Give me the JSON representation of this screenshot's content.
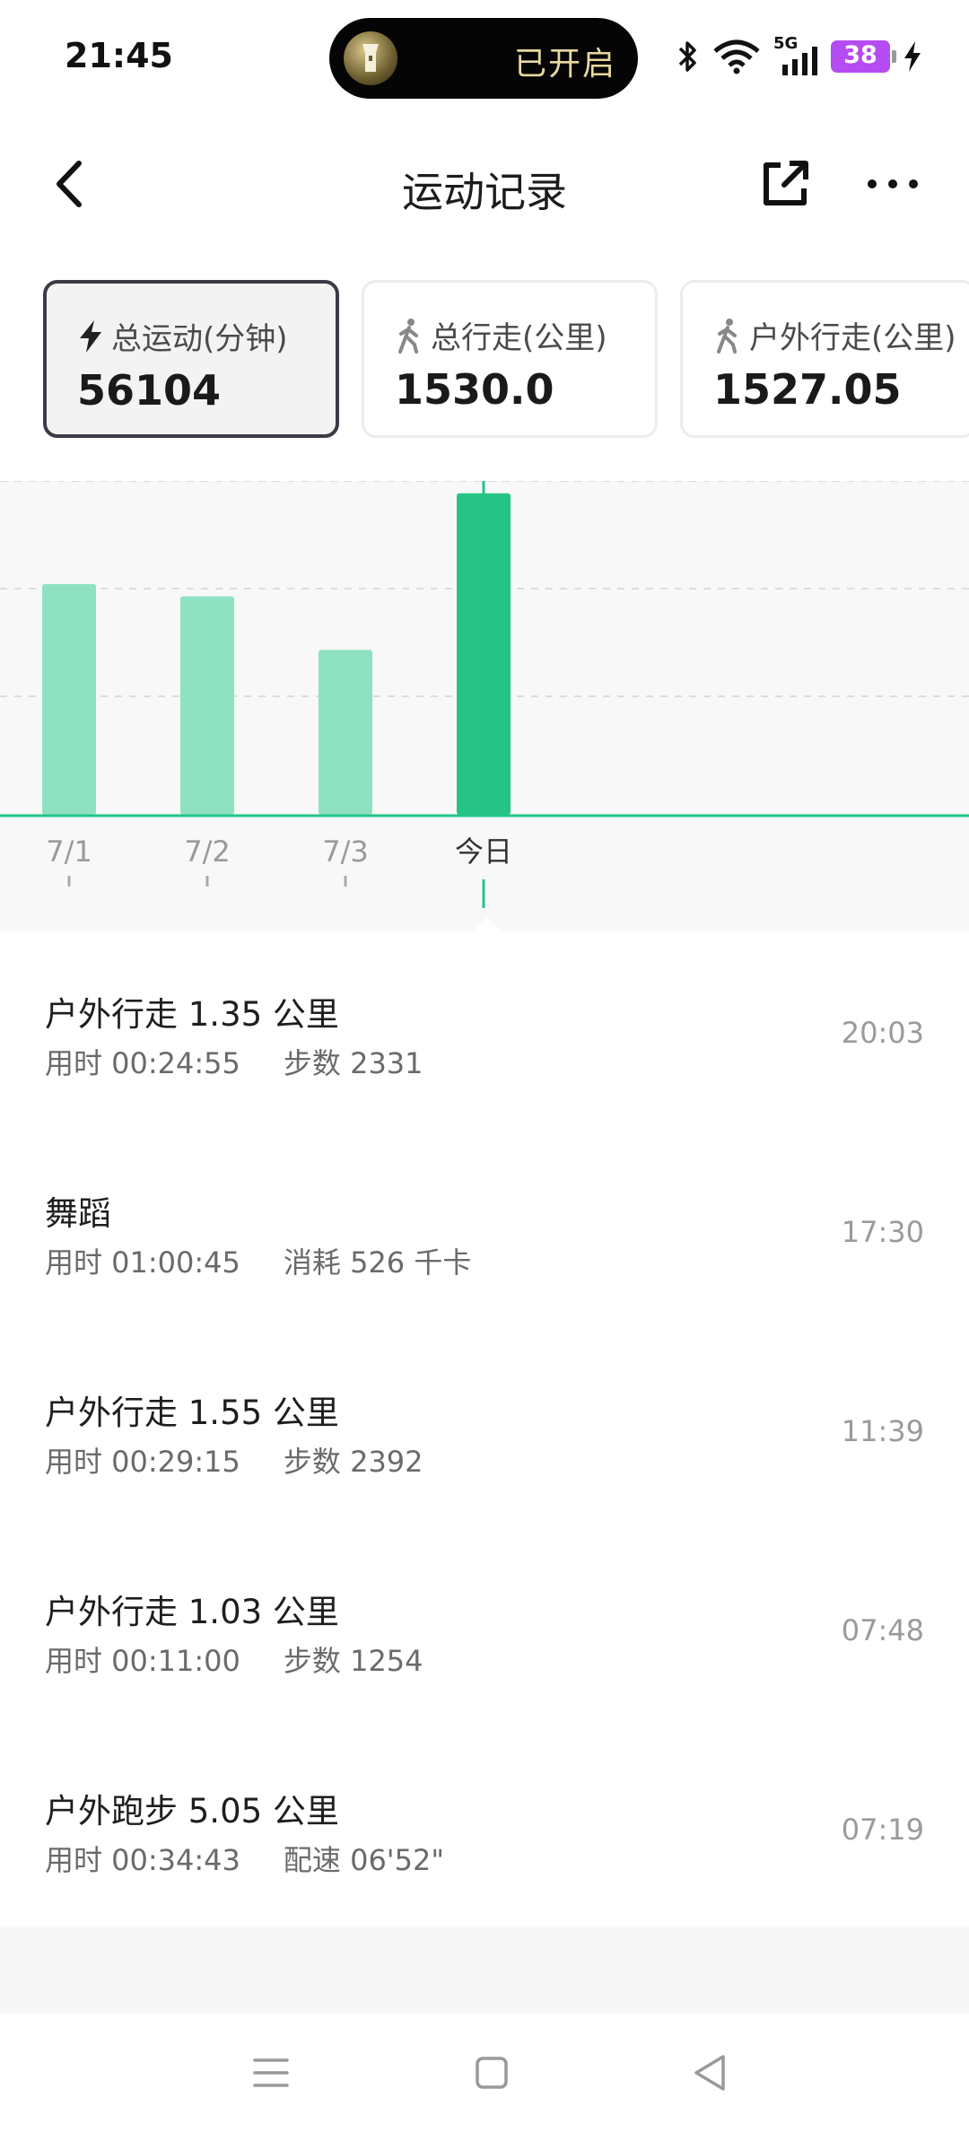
{
  "status_bar": {
    "time": "21:45",
    "pill_text": "已开启",
    "network": "5G",
    "battery": "38"
  },
  "header": {
    "title": "运动记录"
  },
  "cards": [
    {
      "icon": "lightning-icon",
      "label": "总运动(分钟)",
      "value": "56104",
      "active": true
    },
    {
      "icon": "walking-icon",
      "label": "总行走(公里)",
      "value": "1530.0",
      "active": false
    },
    {
      "icon": "walking-icon",
      "label": "户外行走(公里)",
      "value": "1527.05",
      "active": false
    }
  ],
  "chart_data": {
    "type": "bar",
    "categories": [
      "7/1",
      "7/2",
      "7/3",
      "今日"
    ],
    "values": [
      56,
      53,
      40,
      78
    ],
    "highlight_index": 3,
    "ylim": [
      0,
      81
    ],
    "grid": true,
    "colors": {
      "bar": "#8ee2c1",
      "highlight": "#25c486",
      "baseline": "#25c486"
    }
  },
  "records": [
    {
      "title": "户外行走 1.35 公里",
      "duration": "用时 00:24:55",
      "detail": "步数 2331",
      "time": "20:03"
    },
    {
      "title": "舞蹈",
      "duration": "用时 01:00:45",
      "detail": "消耗 526 千卡",
      "time": "17:30"
    },
    {
      "title": "户外行走 1.55 公里",
      "duration": "用时 00:29:15",
      "detail": "步数 2392",
      "time": "11:39"
    },
    {
      "title": "户外行走 1.03 公里",
      "duration": "用时 00:11:00",
      "detail": "步数 1254",
      "time": "07:48"
    },
    {
      "title": "户外跑步 5.05 公里",
      "duration": "用时 00:34:43",
      "detail": "配速 06'52\"",
      "time": "07:19"
    }
  ]
}
